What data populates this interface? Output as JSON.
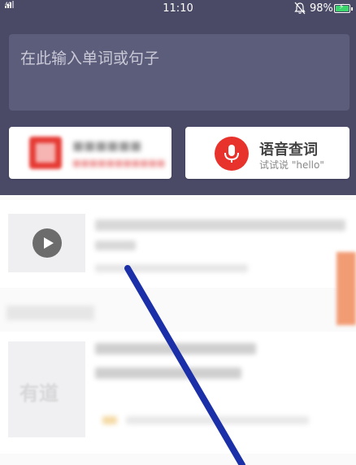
{
  "status_bar": {
    "network": "4G",
    "time": "11:10",
    "battery": "98%",
    "battery_level": 0.98
  },
  "search": {
    "placeholder": "在此输入单词或句子"
  },
  "voice_search": {
    "title": "语音查词",
    "subtitle": "试试说 \"hello\""
  },
  "feed": {
    "thumb_watermark": "有道"
  },
  "colors": {
    "header_bg": "#4a4a67",
    "search_box": "#5c5c7b",
    "accent_red": "#e8332c",
    "annotation_line": "#1b2fa8"
  },
  "icons": {
    "signal": "signal-icon",
    "bell_muted": "bell-off-icon",
    "battery": "battery-charging-icon",
    "microphone": "microphone-icon",
    "play": "play-icon"
  }
}
